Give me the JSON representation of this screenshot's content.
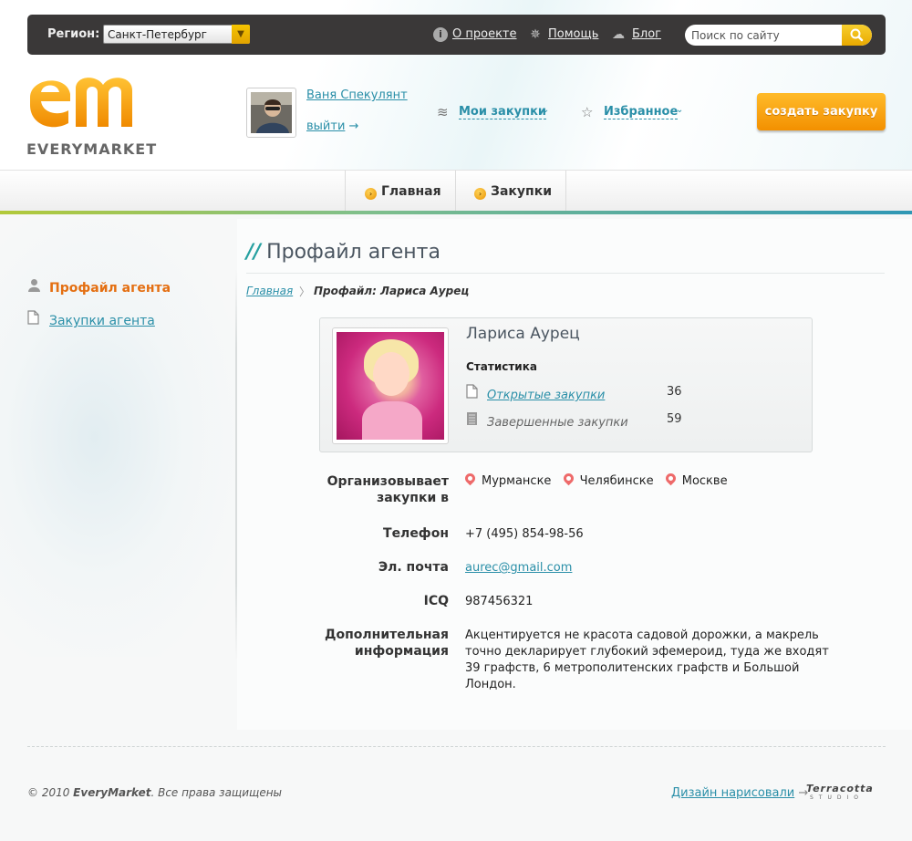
{
  "topbar": {
    "region_label": "Регион:",
    "region_value": "Санкт-Петербург",
    "links": [
      "О проекте",
      "Помощь",
      "Блог"
    ],
    "search_placeholder": "Поиск по сайту"
  },
  "header": {
    "logo_text": "EVERYMARKET",
    "user_name": "Ваня Спекулянт",
    "logout": "выйти",
    "logout_arrow": "→",
    "my_purchases": "Мои закупки",
    "favorites": "Избранное",
    "create_button": "создать закупку"
  },
  "nav": {
    "items": [
      "Главная",
      "Закупки"
    ]
  },
  "sidebar": {
    "items": [
      "Профайл агента",
      "Закупки агента"
    ]
  },
  "page": {
    "title_slashes": "//",
    "title": "Профайл агента",
    "breadcrumb_home": "Главная",
    "breadcrumb_sep": "〉",
    "breadcrumb_current": "Профайл: Лариса Аурец"
  },
  "profile": {
    "name": "Лариса Аурец",
    "stats_title": "Статистика",
    "open_label": "Открытые закупки",
    "open_value": "36",
    "done_label": "Завершенные закупки",
    "done_value": "59"
  },
  "details": {
    "organizes_label_1": "Организовывает",
    "organizes_label_2": "закупки в",
    "cities": [
      "Мурманске",
      "Челябинске",
      "Москве"
    ],
    "phone_label": "Телефон",
    "phone": "+7 (495) 854-98-56",
    "email_label": "Эл. почта",
    "email": "aurec@gmail.com",
    "icq_label": "ICQ",
    "icq": "987456321",
    "extra_label_1": "Дополнительная",
    "extra_label_2": "информация",
    "extra_lines": [
      "Акцентируется не красота садовой дорожки, а макрель",
      "точно декларирует глубокий эфемероид, туда же входят",
      "39 графств, 6 метрополитенских графств и Большой",
      "Лондон."
    ]
  },
  "footer": {
    "copyright_prefix": "© 2010 ",
    "copyright_brand": "EveryMarket",
    "copyright_suffix": ". Все права защищены",
    "design_link": "Дизайн нарисовали",
    "arrow": "→",
    "studio_name": "Terracotta",
    "studio_sub": "STUDIO"
  }
}
